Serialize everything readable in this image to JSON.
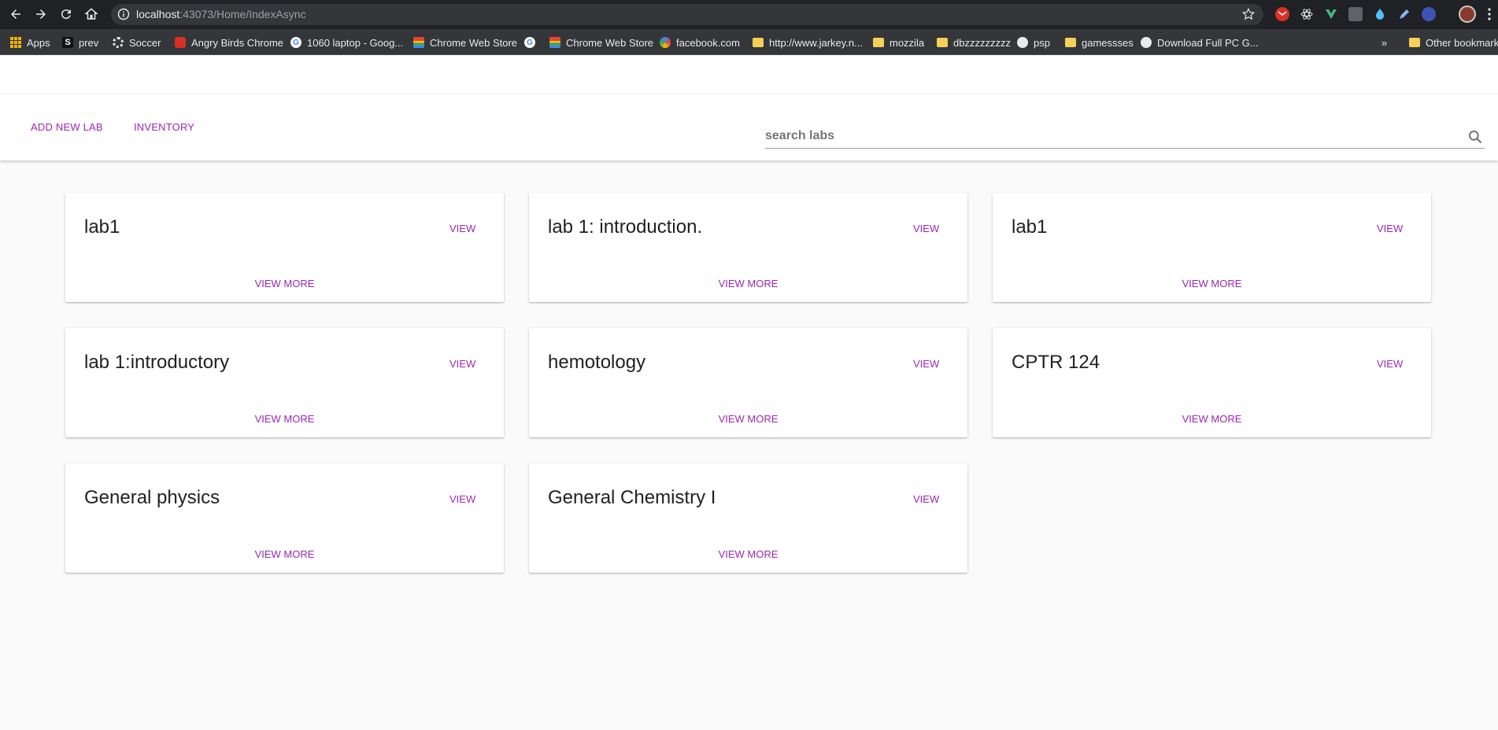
{
  "browser": {
    "url_host": "localhost",
    "url_rest": ":43073/Home/IndexAsync",
    "bookmarks": [
      {
        "label": "Apps",
        "icon": "apps-grid-icon"
      },
      {
        "label": "prev",
        "icon": "s-icon"
      },
      {
        "label": "Soccer",
        "icon": "gear-icon"
      },
      {
        "label": "Angry Birds Chrome",
        "icon": "angry-birds-icon"
      },
      {
        "label": "1060 laptop - Goog...",
        "icon": "google-icon"
      },
      {
        "label": "Chrome Web Store",
        "icon": "web-store-icon"
      },
      {
        "label": "",
        "icon": "google-icon"
      },
      {
        "label": "Chrome Web Store",
        "icon": "web-store-icon"
      },
      {
        "label": "facebook.com",
        "icon": "site-icon"
      },
      {
        "label": "http://www.jarkey.n...",
        "icon": "folder-icon"
      },
      {
        "label": "mozzila",
        "icon": "folder-icon"
      },
      {
        "label": "dbzzzzzzzzz",
        "icon": "folder-icon"
      },
      {
        "label": "psp",
        "icon": "globe-icon"
      },
      {
        "label": "gamessses",
        "icon": "folder-icon"
      },
      {
        "label": "Download Full PC G...",
        "icon": "globe-icon"
      }
    ],
    "overflow": "»",
    "other_bookmarks": "Other bookmarks"
  },
  "header": {
    "add_new_lab": "ADD NEW LAB",
    "inventory": "INVENTORY",
    "search_placeholder": "search labs"
  },
  "labs": [
    {
      "title": "lab1",
      "view": "VIEW",
      "view_more": "VIEW MORE"
    },
    {
      "title": "lab 1: introduction.",
      "view": "VIEW",
      "view_more": "VIEW MORE"
    },
    {
      "title": "lab1",
      "view": "VIEW",
      "view_more": "VIEW MORE"
    },
    {
      "title": "lab 1:introductory",
      "view": "VIEW",
      "view_more": "VIEW MORE"
    },
    {
      "title": "hemotology",
      "view": "VIEW",
      "view_more": "VIEW MORE"
    },
    {
      "title": "CPTR 124",
      "view": "VIEW",
      "view_more": "VIEW MORE"
    },
    {
      "title": "General physics",
      "view": "VIEW",
      "view_more": "VIEW MORE"
    },
    {
      "title": "General Chemistry I",
      "view": "VIEW",
      "view_more": "VIEW MORE"
    }
  ],
  "colors": {
    "accent": "#9c27b0",
    "chrome_dark": "#202124",
    "bookmark_bar": "#35363a"
  }
}
